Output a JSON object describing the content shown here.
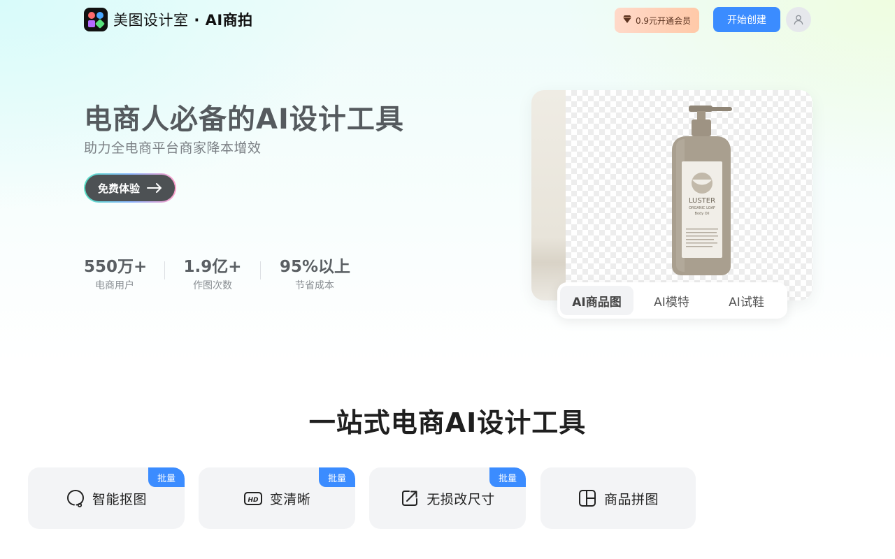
{
  "header": {
    "logo_text_main": "美图设计室",
    "logo_text_sub": "· AI商拍",
    "vip_label": "0.9元开通会员",
    "start_label": "开始创建"
  },
  "hero": {
    "title": "电商人必备的AI设计工具",
    "subtitle": "助力全电商平台商家降本增效",
    "cta_label": "免费体验",
    "stats": [
      {
        "value": "550万+",
        "label": "电商用户"
      },
      {
        "value": "1.9亿+",
        "label": "作图次数"
      },
      {
        "value": "95%以上",
        "label": "节省成本"
      }
    ]
  },
  "showcase": {
    "product_brand": "LUSTER",
    "product_line": "ORGANIC LOAF",
    "product_type": "Body Oil",
    "tabs": [
      {
        "label": "AI商品图",
        "active": true
      },
      {
        "label": "AI模特",
        "active": false
      },
      {
        "label": "AI试鞋",
        "active": false
      }
    ]
  },
  "tools": {
    "title": "一站式电商AI设计工具",
    "cards": [
      {
        "label": "智能抠图",
        "icon": "cutout-icon",
        "badge": "批量"
      },
      {
        "label": "变清晰",
        "icon": "hd-icon",
        "badge": "批量"
      },
      {
        "label": "无损改尺寸",
        "icon": "resize-icon",
        "badge": "批量"
      },
      {
        "label": "商品拼图",
        "icon": "collage-icon",
        "badge": ""
      }
    ]
  },
  "colors": {
    "accent": "#3b8cff",
    "hero_title": "#555a5e",
    "card_bg": "#f3f4f6"
  }
}
